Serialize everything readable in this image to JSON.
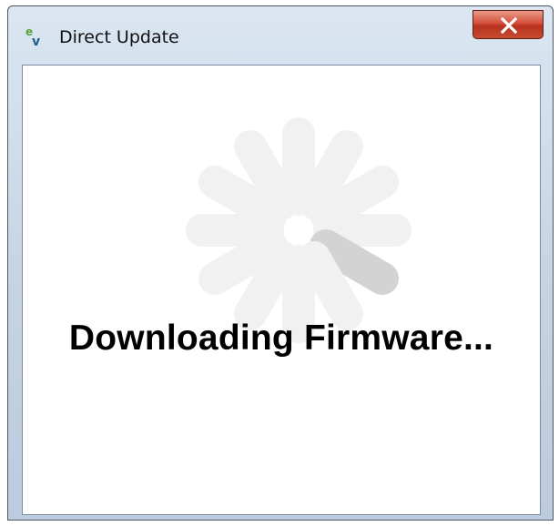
{
  "window": {
    "title": "Direct Update",
    "app_icon": "ev-logo-icon",
    "close_icon": "close-icon",
    "close_button_color": "#c7432d"
  },
  "content": {
    "message": "Downloading Firmware...",
    "spinner_icon": "loading-spinner-icon",
    "spinner_colors": {
      "spoke": "#f1f1f1",
      "active": "#d3d3d3"
    }
  }
}
